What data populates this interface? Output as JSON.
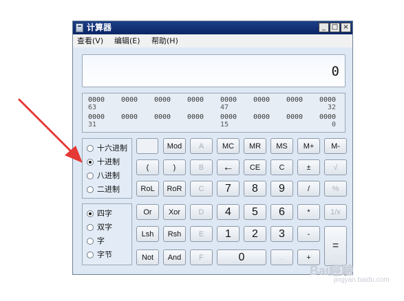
{
  "window": {
    "title": "计算器",
    "controls": {
      "minimize": "_",
      "maximize": "□",
      "close": "×"
    }
  },
  "menu": [
    "查看(V)",
    "编辑(E)",
    "帮助(H)"
  ],
  "display": {
    "value": "0"
  },
  "bits": {
    "row1": [
      "0000",
      "0000",
      "0000",
      "0000",
      "0000",
      "0000",
      "0000",
      "0000"
    ],
    "row1_labels": [
      "63",
      "47",
      "32"
    ],
    "row2": [
      "0000",
      "0000",
      "0000",
      "0000",
      "0000",
      "0000",
      "0000",
      "0000"
    ],
    "row2_labels": [
      "31",
      "15",
      "0"
    ]
  },
  "base_options": [
    {
      "label": "十六进制",
      "checked": false
    },
    {
      "label": "十进制",
      "checked": true
    },
    {
      "label": "八进制",
      "checked": false
    },
    {
      "label": "二进制",
      "checked": false
    }
  ],
  "word_options": [
    {
      "label": "四字",
      "checked": true
    },
    {
      "label": "双字",
      "checked": false
    },
    {
      "label": "字",
      "checked": false
    },
    {
      "label": "字节",
      "checked": false
    }
  ],
  "buttons": {
    "r1": [
      "",
      "Mod",
      "A",
      "MC",
      "MR",
      "MS",
      "M+",
      "M-"
    ],
    "r2": [
      "(",
      ")",
      "B",
      "←",
      "CE",
      "C",
      "±",
      "√"
    ],
    "r3": [
      "RoL",
      "RoR",
      "C",
      "7",
      "8",
      "9",
      "/",
      "%"
    ],
    "r4": [
      "Or",
      "Xor",
      "D",
      "4",
      "5",
      "6",
      "*",
      "1/x"
    ],
    "r5": [
      "Lsh",
      "Rsh",
      "E",
      "1",
      "2",
      "3",
      "-",
      "="
    ],
    "r6": [
      "Not",
      "And",
      "F",
      "0",
      ".",
      "+"
    ]
  },
  "watermark": {
    "text": "Bai經驗",
    "sub": "jingyan.baidu.com"
  },
  "colors": {
    "titlebar": "#0b2565",
    "window_bg": "#dde8f4",
    "arrow": "#e53935"
  }
}
